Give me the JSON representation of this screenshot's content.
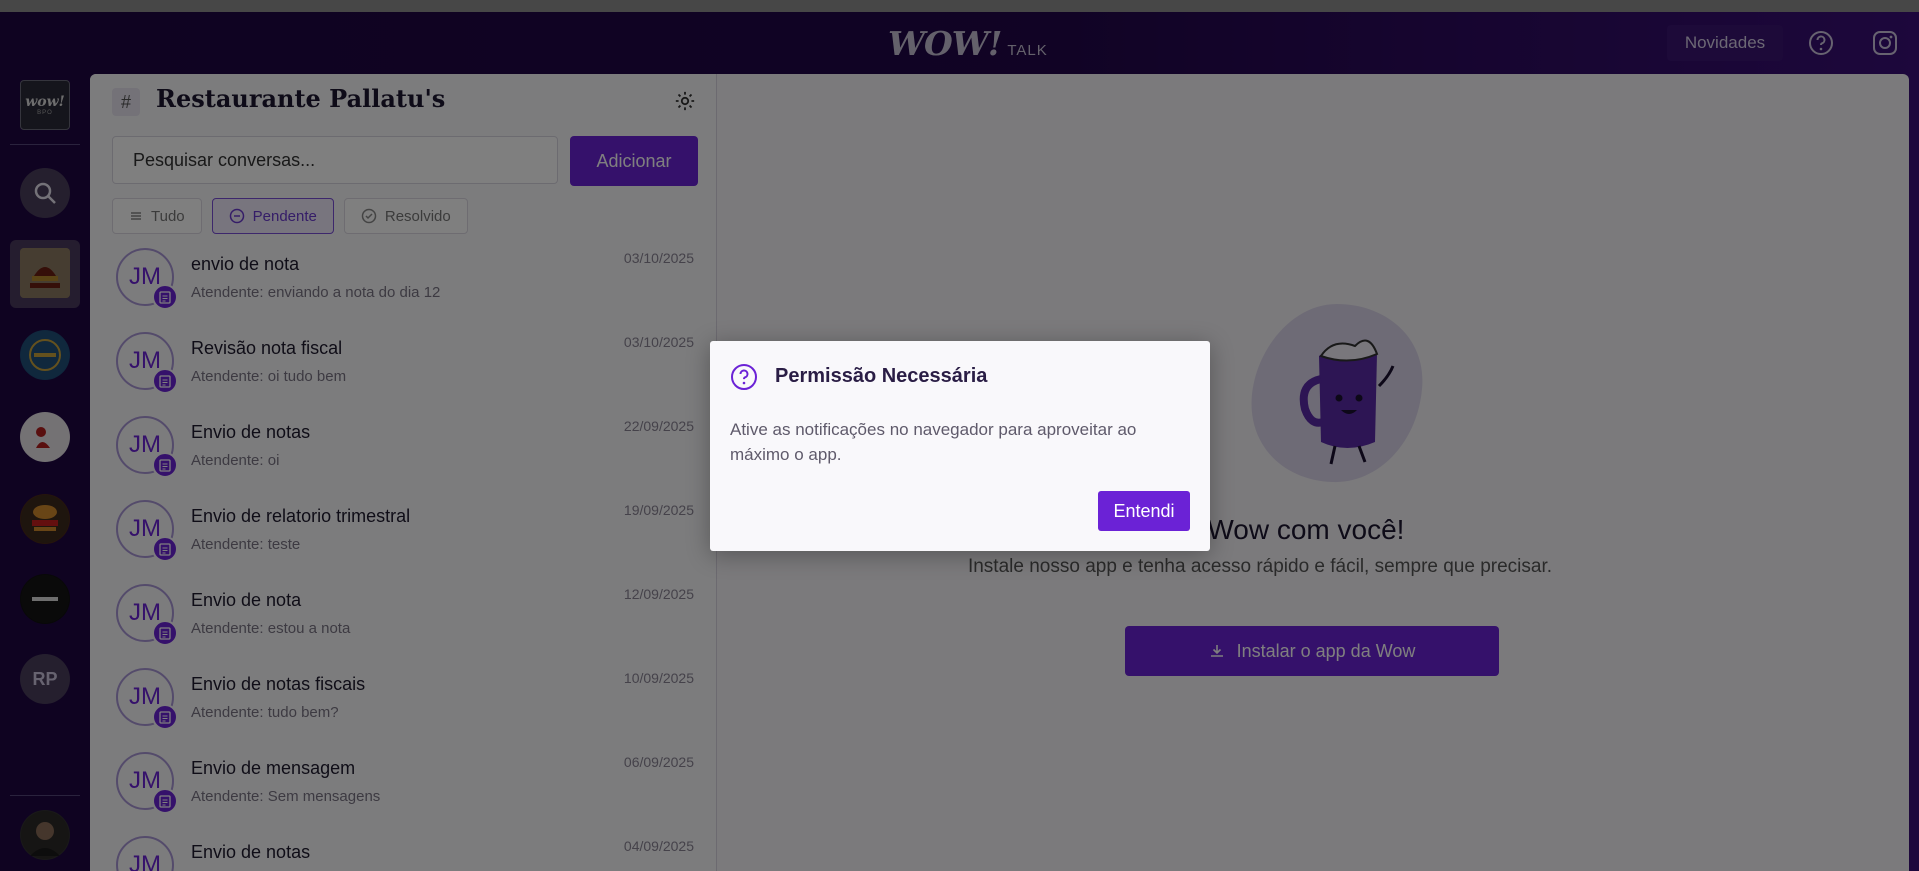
{
  "app": {
    "logo_main": "WOW!",
    "logo_sub": "TALK",
    "news_label": "Novidades",
    "rail_logo_main": "wow!",
    "rail_logo_sub": "BPO",
    "rail_user_initials": "RP"
  },
  "sidebar": {
    "hash": "#",
    "title": "Restaurante Pallatu's",
    "search_placeholder": "Pesquisar conversas...",
    "add_label": "Adicionar",
    "filters": [
      {
        "label": "Tudo",
        "icon": "list-icon",
        "active": false
      },
      {
        "label": "Pendente",
        "icon": "clock-icon",
        "active": true
      },
      {
        "label": "Resolvido",
        "icon": "check-circle-icon",
        "active": false
      }
    ],
    "conversations": [
      {
        "initials": "JM",
        "title": "envio de nota",
        "subtitle": "Atendente: enviando a nota do dia 12",
        "date": "03/10/2025"
      },
      {
        "initials": "JM",
        "title": "Revisão nota fiscal",
        "subtitle": "Atendente: oi tudo bem",
        "date": "03/10/2025"
      },
      {
        "initials": "JM",
        "title": "Envio de notas",
        "subtitle": "Atendente: oi",
        "date": "22/09/2025"
      },
      {
        "initials": "JM",
        "title": "Envio de relatorio trimestral",
        "subtitle": "Atendente: teste",
        "date": "19/09/2025"
      },
      {
        "initials": "JM",
        "title": "Envio de nota",
        "subtitle": "Atendente: estou a nota",
        "date": "12/09/2025"
      },
      {
        "initials": "JM",
        "title": "Envio de notas fiscais",
        "subtitle": "Atendente: tudo bem?",
        "date": "10/09/2025"
      },
      {
        "initials": "JM",
        "title": "Envio de mensagem",
        "subtitle": "Atendente: Sem mensagens",
        "date": "06/09/2025"
      },
      {
        "initials": "JM",
        "title": "Envio de notas",
        "subtitle": "",
        "date": "04/09/2025"
      }
    ]
  },
  "promo": {
    "title": "Leve a Wow com você!",
    "subtitle": "Instale nosso app e tenha acesso rápido e fácil, sempre que precisar.",
    "install_label": "Instalar o app da Wow"
  },
  "modal": {
    "title": "Permissão Necessária",
    "body": "Ative as notificações no navegador para aproveitar ao máximo o app.",
    "button": "Entendi"
  },
  "colors": {
    "accent": "#6b22d6",
    "topbar": "#22074a"
  }
}
